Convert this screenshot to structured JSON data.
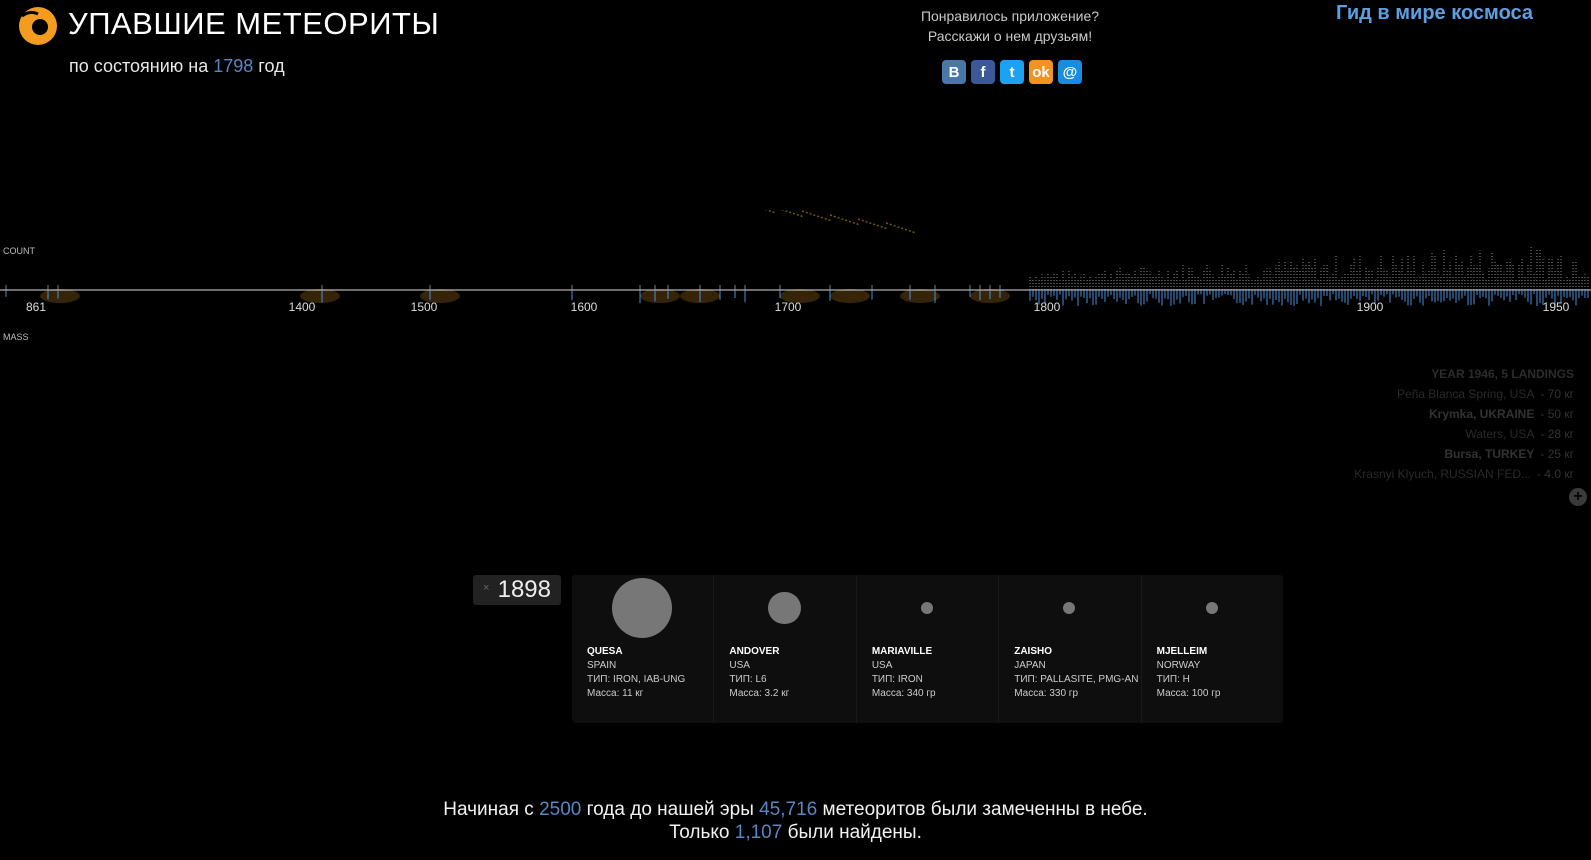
{
  "header": {
    "title": "УПАВШИЕ МЕТЕОРИТЫ",
    "subtitle_prefix": "по состоянию на",
    "subtitle_year": "1798",
    "subtitle_suffix": "год"
  },
  "share": {
    "line1": "Понравилось приложение?",
    "line2": "Расскажи о нем друзьям!",
    "buttons": [
      {
        "icon": "vk-icon",
        "glyph": "В",
        "color": "#4a76a8"
      },
      {
        "icon": "facebook-icon",
        "glyph": "f",
        "color": "#3b5998"
      },
      {
        "icon": "twitter-icon",
        "glyph": "t",
        "color": "#1da1f2"
      },
      {
        "icon": "odnoklassniki-icon",
        "glyph": "ok",
        "color": "#f29221"
      },
      {
        "icon": "mailru-icon",
        "glyph": "@",
        "color": "#168de2"
      }
    ]
  },
  "guide_link": "Гид в мире космоса",
  "timeline": {
    "count_label": "COUNT",
    "mass_label": "MASS",
    "ticks": [
      "861",
      "1400",
      "1500",
      "1600",
      "1700",
      "1800",
      "1900",
      "1950"
    ],
    "current_year": 1798,
    "colors": {
      "count": "#cccccc",
      "mass": "#4a8fdc",
      "glow": "#f5a623"
    }
  },
  "legend": {
    "header": "YEAR 1946, 5 LANDINGS",
    "rows": [
      {
        "place": "Peña Blanca Spring, USA",
        "mass": "- 70 кг",
        "bold": false
      },
      {
        "place": "Krymka, UKRAINE",
        "mass": "- 50 кг",
        "bold": true
      },
      {
        "place": "Waters, USA",
        "mass": "- 28 кг",
        "bold": false
      },
      {
        "place": "Bursa, TURKEY",
        "mass": "- 25 кг",
        "bold": true
      },
      {
        "place": "Krasnyi Klyuch, RUSSIAN FED...",
        "mass": "- 4.0 кг",
        "bold": false
      }
    ]
  },
  "year_box": {
    "close": "×",
    "year": "1898"
  },
  "cards": [
    {
      "name": "QUESA",
      "country": "SPAIN",
      "type": "ТИП: IRON, IAB-UNG",
      "mass": "Масса: 11 кг",
      "mass_kg": 11
    },
    {
      "name": "ANDOVER",
      "country": "USA",
      "type": "ТИП: L6",
      "mass": "Масса: 3.2 кг",
      "mass_kg": 3.2
    },
    {
      "name": "MARIAVILLE",
      "country": "USA",
      "type": "ТИП: IRON",
      "mass": "Масса: 340 гр",
      "mass_kg": 0.34
    },
    {
      "name": "ZAISHO",
      "country": "JAPAN",
      "type": "ТИП: PALLASITE, PMG-AN",
      "mass": "Масса: 330 гр",
      "mass_kg": 0.33
    },
    {
      "name": "MJELLEIM",
      "country": "NORWAY",
      "type": "ТИП: H",
      "mass": "Масса: 100 гр",
      "mass_kg": 0.1
    }
  ],
  "footer": {
    "l1a": "Начиная с",
    "l1_year": "2500",
    "l1b": "года до нашей эры",
    "l1_count": "45,716",
    "l1c": "метеоритов были замеченны в небе",
    "dot": ".",
    "l2a": "Только",
    "l2_count": "1,107",
    "l2b": "были найдены"
  }
}
